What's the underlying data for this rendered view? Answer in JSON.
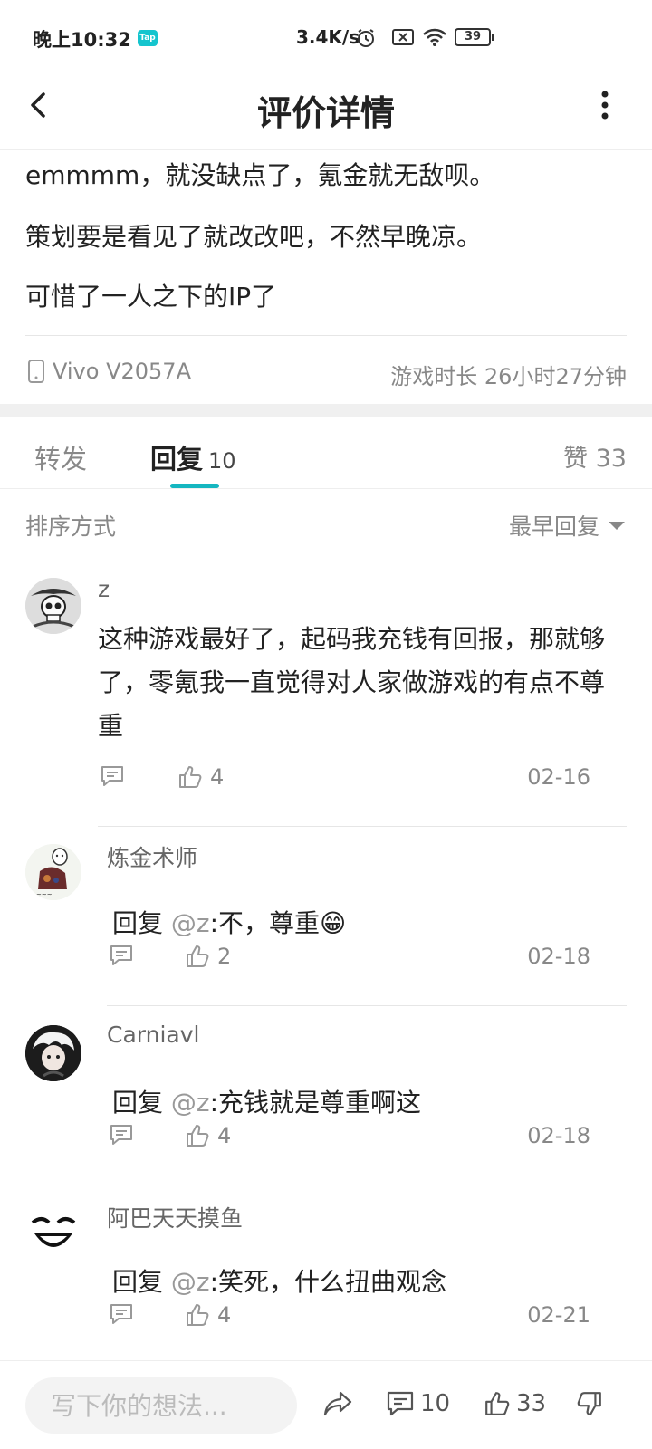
{
  "status": {
    "time": "晚上10:32",
    "tap_label": "Tap",
    "speed": "3.4K/s",
    "battery": "39"
  },
  "header": {
    "title": "评价详情"
  },
  "review": {
    "lines": [
      "emmmm，就没缺点了，氪金就无敌呗。",
      "策划要是看见了就改改吧，不然早晚凉。",
      "可惜了一人之下的IP了"
    ],
    "device": "Vivo V2057A",
    "playtime": "游戏时长 26小时27分钟"
  },
  "tabs": {
    "repost": "转发",
    "reply": "回复",
    "reply_count": "10",
    "likes": "赞 33"
  },
  "sort": {
    "label": "排序方式",
    "value": "最早回复"
  },
  "comments": [
    {
      "user": "z",
      "text": "这种游戏最好了，起码我充钱有回报，那就够了，零氪我一直觉得对人家做游戏的有点不尊重",
      "likes": "4",
      "date": "02-16"
    },
    {
      "user": "炼金术师",
      "prefix": "回复 ",
      "at": "@z",
      "text": ":不，尊重",
      "emoji": "😁",
      "likes": "2",
      "date": "02-18"
    },
    {
      "user": "Carniavl",
      "prefix": "回复 ",
      "at": "@z",
      "text": ":充钱就是尊重啊这",
      "likes": "4",
      "date": "02-18"
    },
    {
      "user": "阿巴天天摸鱼",
      "prefix": "回复 ",
      "at": "@z",
      "text": ":笑死，什么扭曲观念",
      "likes": "4",
      "date": "02-21"
    }
  ],
  "bottombar": {
    "placeholder": "写下你的想法...",
    "comments": "10",
    "likes": "33"
  }
}
